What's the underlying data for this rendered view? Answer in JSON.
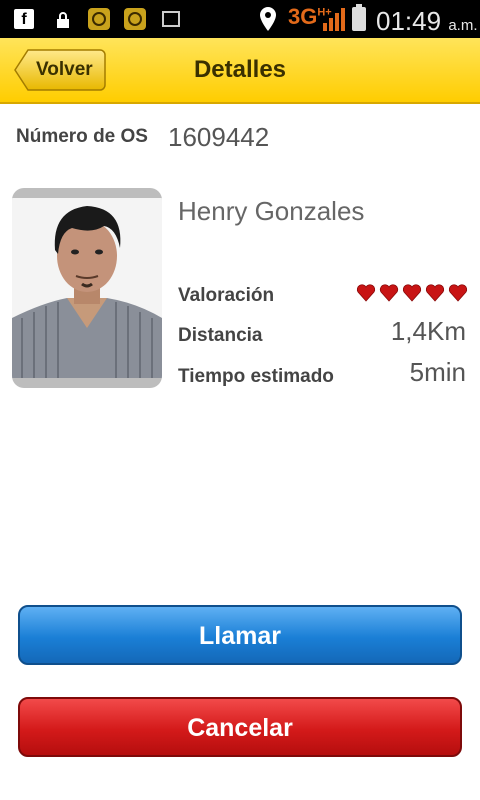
{
  "status_bar": {
    "fb_icon": "facebook-icon",
    "network": "3G",
    "network_sup": "H+",
    "time": "01:49",
    "ampm": "a.m."
  },
  "header": {
    "back_label": "Volver",
    "title": "Detalles",
    "color": "#ffd21a"
  },
  "order": {
    "label": "Número de OS",
    "value": "1609442"
  },
  "driver": {
    "name": "Henry Gonzales",
    "rating_label": "Valoración",
    "rating_value": 5,
    "rating_max": 5,
    "distance_label": "Distancia",
    "distance_value": "1,4Km",
    "time_label": "Tiempo estimado",
    "time_value": "5min"
  },
  "actions": {
    "call_label": "Llamar",
    "cancel_label": "Cancelar",
    "call_color": "#1a7fd6",
    "cancel_color": "#d41a1a"
  }
}
